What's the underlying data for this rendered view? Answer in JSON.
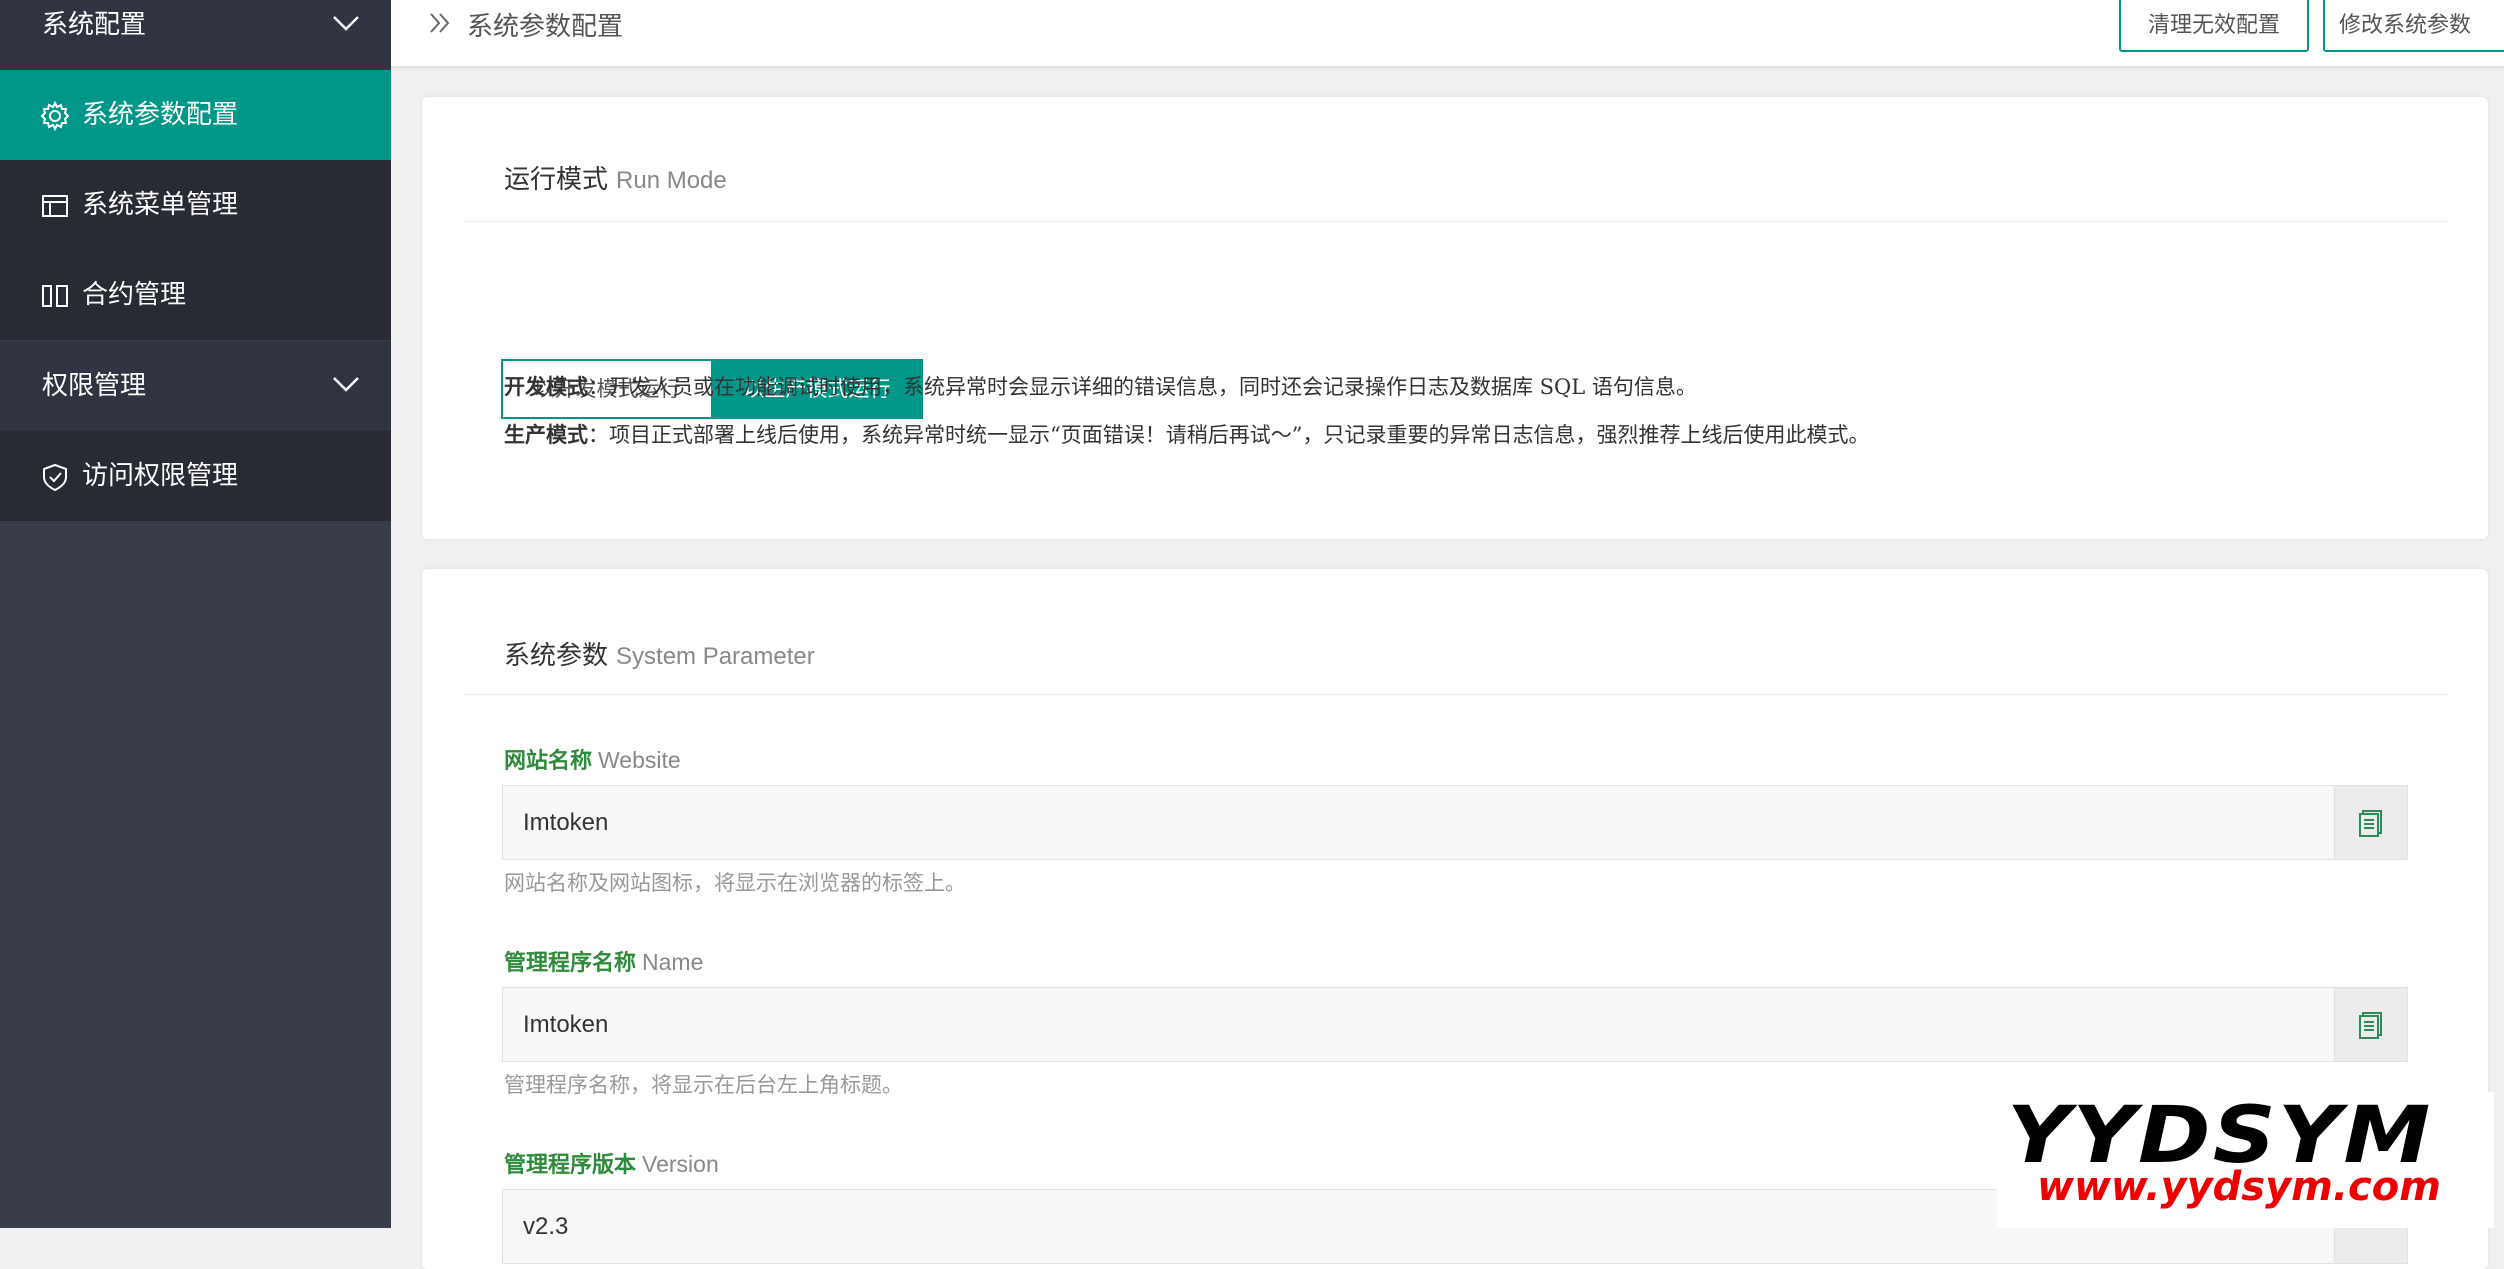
{
  "sidebar": {
    "group_system": "系统配置",
    "items_system": [
      {
        "label": "系统参数配置",
        "icon": "gear-icon"
      },
      {
        "label": "系统菜单管理",
        "icon": "window-icon"
      },
      {
        "label": "合约管理",
        "icon": "columns-icon"
      }
    ],
    "group_auth": "权限管理",
    "items_auth": [
      {
        "label": "访问权限管理",
        "icon": "shield-icon"
      }
    ],
    "active_color": "#009688"
  },
  "header": {
    "breadcrumb": "系统参数配置",
    "btn_clean": "清理无效配置",
    "btn_edit": "修改系统参数"
  },
  "run_mode": {
    "title_zh": "运行模式",
    "title_en": "Run Mode",
    "btn_dev": "以开发模式运行",
    "btn_prod": "以生产模式运行",
    "selected": "以生产模式运行",
    "dev_label": "开发模式",
    "dev_desc": "：开发人员或在功能调试时使用，系统异常时会显示详细的错误信息，同时还会记录操作日志及数据库 SQL 语句信息。",
    "prod_label": "生产模式",
    "prod_desc": "：项目正式部署上线后使用，系统异常时统一显示“页面错误！请稍后再试～”，只记录重要的异常日志信息，强烈推荐上线后使用此模式。"
  },
  "system_param": {
    "title_zh": "系统参数",
    "title_en": "System Parameter",
    "fields": [
      {
        "label_zh": "网站名称",
        "label_en": "Website",
        "value": "Imtoken",
        "help": "网站名称及网站图标，将显示在浏览器的标签上。"
      },
      {
        "label_zh": "管理程序名称",
        "label_en": "Name",
        "value": "Imtoken",
        "help": "管理程序名称，将显示在后台左上角标题。"
      },
      {
        "label_zh": "管理程序版本",
        "label_en": "Version",
        "value": "v2.3",
        "help": ""
      }
    ]
  },
  "watermark": {
    "logo": "YYDSYM",
    "url": "www.yydsym.com"
  }
}
